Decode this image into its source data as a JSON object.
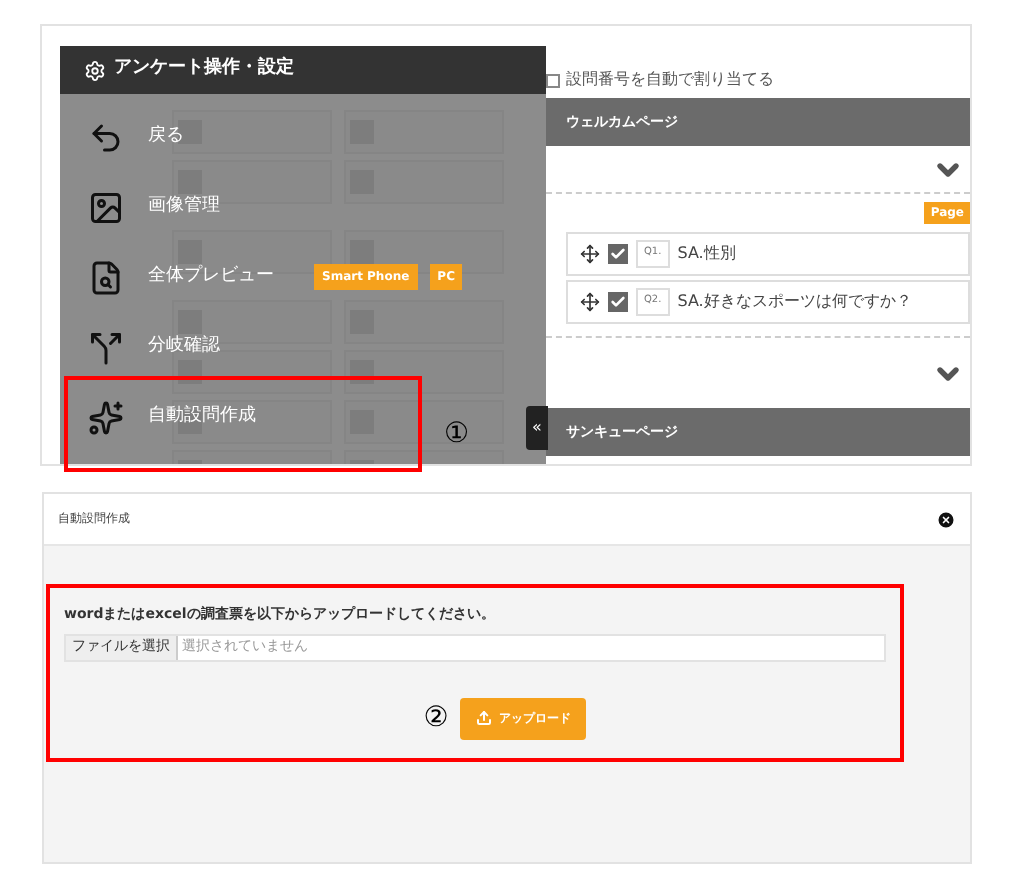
{
  "panel": {
    "title": "アンケート操作・設定",
    "menu": [
      {
        "kind": "back",
        "label": "戻る"
      },
      {
        "kind": "image",
        "label": "画像管理"
      },
      {
        "kind": "preview",
        "label": "全体プレビュー",
        "badges": [
          "Smart Phone",
          "PC"
        ]
      },
      {
        "kind": "branch",
        "label": "分岐確認"
      },
      {
        "kind": "auto",
        "label": "自動設問作成"
      }
    ],
    "collapse": "«"
  },
  "editor": {
    "auto_number": {
      "label": "設問番号を自動で割り当てる",
      "checked": false
    },
    "welcome": "ウェルカムページ",
    "page_badge": "Page",
    "questions": [
      {
        "number": "Q1.",
        "text": "SA.性別",
        "checked": true
      },
      {
        "number": "Q2.",
        "text": "SA.好きなスポーツは何ですか？",
        "checked": true
      }
    ],
    "thanks": "サンキューページ"
  },
  "marker_1": "①",
  "dialog": {
    "title": "自動設問作成",
    "instruction": "wordまたはexcelの調査票を以下からアップロードしてください。",
    "file_button": "ファイルを選択",
    "file_placeholder": "選択されていません",
    "marker": "②",
    "upload": "アップロード"
  }
}
